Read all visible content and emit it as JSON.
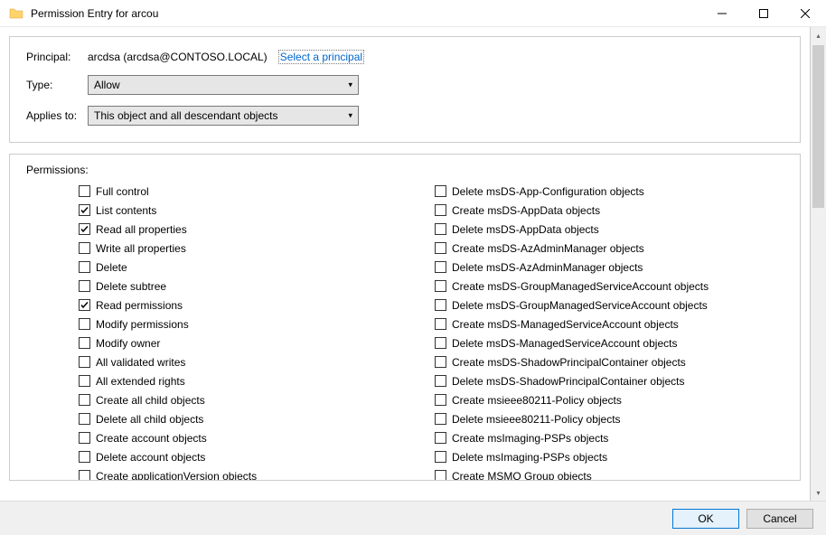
{
  "title": "Permission Entry for arcou",
  "labels": {
    "principal": "Principal:",
    "type": "Type:",
    "applies_to": "Applies to:",
    "permissions": "Permissions:"
  },
  "principal_value": "arcdsa (arcdsa@CONTOSO.LOCAL)",
  "select_principal_link": "Select a principal",
  "type_value": "Allow",
  "applies_to_value": "This object and all descendant objects",
  "permissions_left": [
    {
      "label": "Full control",
      "checked": false
    },
    {
      "label": "List contents",
      "checked": true
    },
    {
      "label": "Read all properties",
      "checked": true
    },
    {
      "label": "Write all properties",
      "checked": false
    },
    {
      "label": "Delete",
      "checked": false
    },
    {
      "label": "Delete subtree",
      "checked": false
    },
    {
      "label": "Read permissions",
      "checked": true
    },
    {
      "label": "Modify permissions",
      "checked": false
    },
    {
      "label": "Modify owner",
      "checked": false
    },
    {
      "label": "All validated writes",
      "checked": false
    },
    {
      "label": "All extended rights",
      "checked": false
    },
    {
      "label": "Create all child objects",
      "checked": false
    },
    {
      "label": "Delete all child objects",
      "checked": false
    },
    {
      "label": "Create account objects",
      "checked": false
    },
    {
      "label": "Delete account objects",
      "checked": false
    },
    {
      "label": "Create applicationVersion objects",
      "checked": false
    }
  ],
  "permissions_right": [
    {
      "label": "Delete msDS-App-Configuration objects",
      "checked": false
    },
    {
      "label": "Create msDS-AppData objects",
      "checked": false
    },
    {
      "label": "Delete msDS-AppData objects",
      "checked": false
    },
    {
      "label": "Create msDS-AzAdminManager objects",
      "checked": false
    },
    {
      "label": "Delete msDS-AzAdminManager objects",
      "checked": false
    },
    {
      "label": "Create msDS-GroupManagedServiceAccount objects",
      "checked": false
    },
    {
      "label": "Delete msDS-GroupManagedServiceAccount objects",
      "checked": false
    },
    {
      "label": "Create msDS-ManagedServiceAccount objects",
      "checked": false
    },
    {
      "label": "Delete msDS-ManagedServiceAccount objects",
      "checked": false
    },
    {
      "label": "Create msDS-ShadowPrincipalContainer objects",
      "checked": false
    },
    {
      "label": "Delete msDS-ShadowPrincipalContainer objects",
      "checked": false
    },
    {
      "label": "Create msieee80211-Policy objects",
      "checked": false
    },
    {
      "label": "Delete msieee80211-Policy objects",
      "checked": false
    },
    {
      "label": "Create msImaging-PSPs objects",
      "checked": false
    },
    {
      "label": "Delete msImaging-PSPs objects",
      "checked": false
    },
    {
      "label": "Create MSMQ Group objects",
      "checked": false
    }
  ],
  "buttons": {
    "ok": "OK",
    "cancel": "Cancel"
  }
}
